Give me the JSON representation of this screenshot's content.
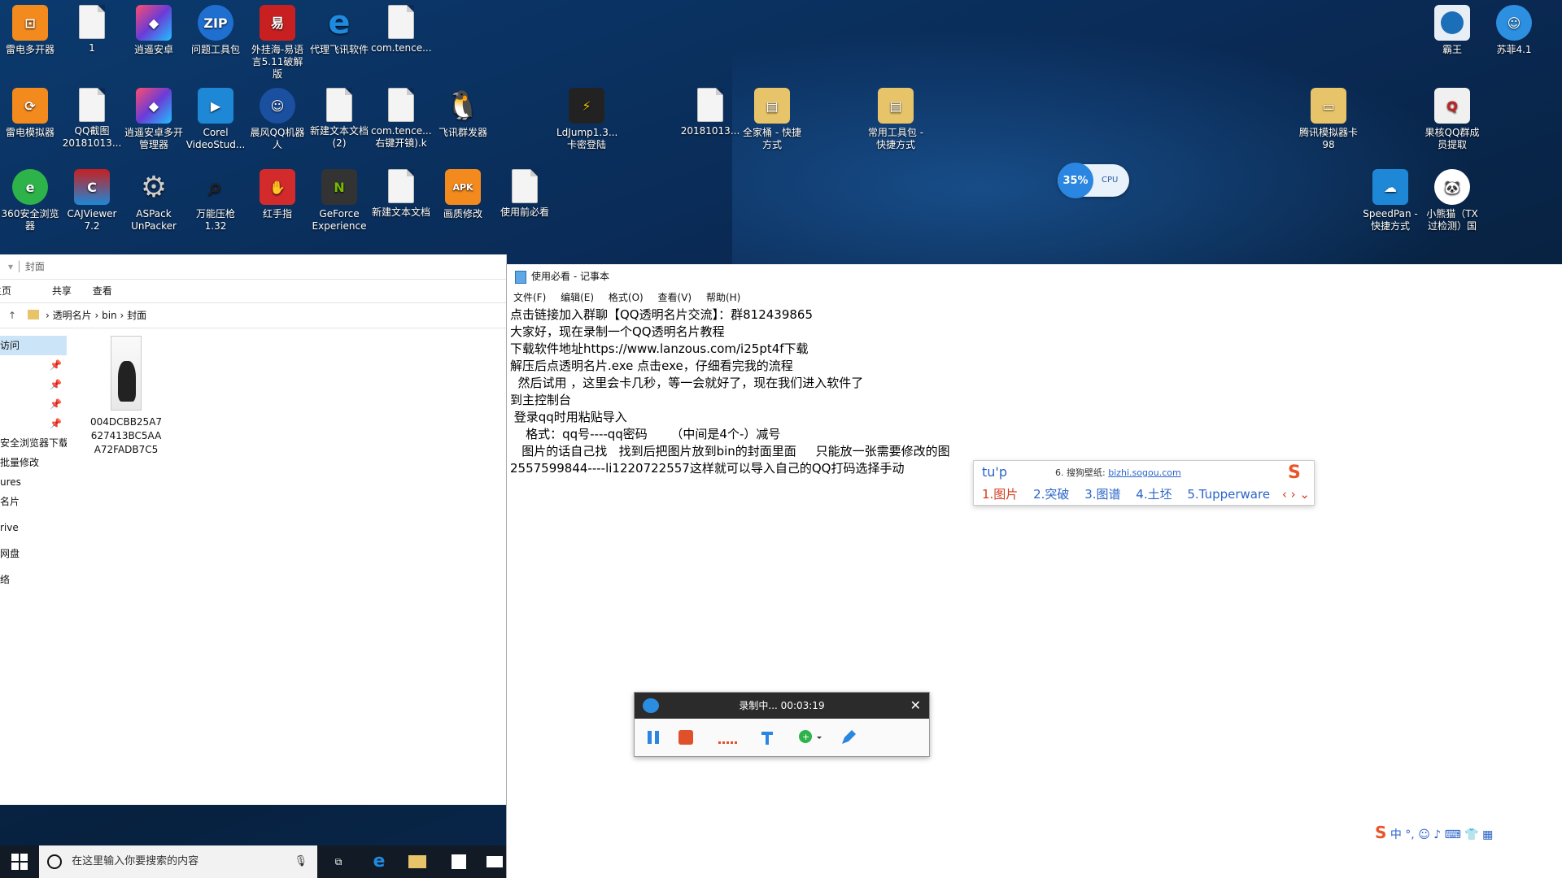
{
  "desktop": {
    "icons": [
      {
        "label": "雷电多开器",
        "icon": "ld-multi-icon",
        "color": "#f28a1d"
      },
      {
        "label": "1",
        "icon": "document-icon",
        "color": "#f4f4f4"
      },
      {
        "label": "逍遥安卓",
        "icon": "xiaoyao-icon",
        "color": "#6b3bd6"
      },
      {
        "label": "问题工具包",
        "icon": "zip-icon",
        "color": "#1f6fd1"
      },
      {
        "label": "外挂海-易语言5.11破解版",
        "icon": "eyuyan-icon",
        "color": "#c82020"
      },
      {
        "label": "代理飞讯软件",
        "icon": "ie-icon",
        "color": "#1f8be0"
      },
      {
        "label": "com.tence...",
        "icon": "document-icon",
        "color": "#f4f4f4"
      },
      {
        "label": "霸王",
        "icon": "bawang-icon",
        "color": "#1b6fb8"
      },
      {
        "label": "苏菲4.1",
        "icon": "doraemon-icon",
        "color": "#2d8fe0"
      },
      {
        "label": "雷电模拟器",
        "icon": "ld-emulator-icon",
        "color": "#f28a1d"
      },
      {
        "label": "QQ截图20181013...",
        "icon": "screenshot-icon",
        "color": "#f4f4f4"
      },
      {
        "label": "逍遥安卓多开管理器",
        "icon": "xiaoyao-multi-icon",
        "color": "#6b3bd6"
      },
      {
        "label": "Corel VideoStud...",
        "icon": "corel-icon",
        "color": "#1e88d6"
      },
      {
        "label": "晨风QQ机器人",
        "icon": "robot-icon",
        "color": "#1b4fa0"
      },
      {
        "label": "新建文本文档(2)",
        "icon": "document-icon",
        "color": "#f4f4f4"
      },
      {
        "label": "com.tence...右键开镜).k",
        "icon": "document-icon",
        "color": "#f4f4f4"
      },
      {
        "label": "飞讯群发器",
        "icon": "qq-penguin-icon",
        "color": "#1b1b1b"
      },
      {
        "label": "LdJump1.3...卡密登陆",
        "icon": "ldjump-icon",
        "color": "#222"
      },
      {
        "label": "20181013...",
        "icon": "document-icon",
        "color": "#f4f4f4"
      },
      {
        "label": "全家桶 - 快捷方式",
        "icon": "folder-shortcut-icon",
        "color": "#e7c46a"
      },
      {
        "label": "常用工具包 - 快捷方式",
        "icon": "folder-shortcut-icon",
        "color": "#e7c46a"
      },
      {
        "label": "腾讯模拟器卡98",
        "icon": "folder-icon",
        "color": "#e7c46a"
      },
      {
        "label": "果核QQ群成员提取",
        "icon": "qq-group-icon",
        "color": "#c82020"
      },
      {
        "label": "360安全浏览器",
        "icon": "browser-360-icon",
        "color": "#2db34a"
      },
      {
        "label": "CAJViewer 7.2",
        "icon": "cajviewer-icon",
        "color": "#c82020"
      },
      {
        "label": "ASPack UnPacker",
        "icon": "gear-icon",
        "color": "#777"
      },
      {
        "label": "万能压枪1.32",
        "icon": "magnifier-icon",
        "color": "#333"
      },
      {
        "label": "红手指",
        "icon": "red-finger-icon",
        "color": "#d32b2b"
      },
      {
        "label": "GeForce Experience",
        "icon": "nvidia-icon",
        "color": "#333"
      },
      {
        "label": "新建文本文档",
        "icon": "document-icon",
        "color": "#f4f4f4"
      },
      {
        "label": "画质修改",
        "icon": "apk-icon",
        "color": "#f28a1d"
      },
      {
        "label": "使用前必看",
        "icon": "document-icon",
        "color": "#f4f4f4"
      },
      {
        "label": "SpeedPan - 快捷方式",
        "icon": "cloud-icon",
        "color": "#1e88d6"
      },
      {
        "label": "小熊猫（TX过检测）国",
        "icon": "panda-icon",
        "color": "#fff"
      }
    ],
    "cpu": {
      "percent": "35%",
      "label": "CPU"
    }
  },
  "explorer": {
    "title": "封面",
    "ribbon": [
      "主页",
      "共享",
      "查看"
    ],
    "breadcrumb": [
      "透明名片",
      "bin",
      "封面"
    ],
    "nav": [
      "访问",
      "",
      "",
      "",
      "",
      "安全浏览器下载",
      "批量修改",
      "ures",
      "名片",
      "rive",
      "网盘",
      "络"
    ],
    "file": {
      "name": "004DCBB25A7627413BC5AAA72FADB7C5"
    }
  },
  "notepad": {
    "title": "使用必看 - 记事本",
    "menu": [
      "文件(F)",
      "编辑(E)",
      "格式(O)",
      "查看(V)",
      "帮助(H)"
    ],
    "lines": [
      "点击链接加入群聊【QQ透明名片交流】：群812439865",
      "大家好，现在录制一个QQ透明名片教程",
      "下载软件地址https://www.lanzous.com/i25pt4f下载",
      "解压后点透明名片.exe 点击exe，仔细看完我的流程",
      "  然后试用 ，这里会卡几秒，等一会就好了，现在我们进入软件了",
      "到主控制台",
      " 登录qq时用粘贴导入",
      "    格式：qq号----qq密码      （中间是4个-）减号",
      "   图片的话自己找   找到后把图片放到bin的封面里面     只能放一张需要修改的图",
      "2557599844----li1220722557这样就可以导入自己的QQ打码选择手动"
    ]
  },
  "ime": {
    "input": "tu'p",
    "tip_num": "6.",
    "tip_text": "搜狗壁纸:",
    "tip_link": "bizhi.sogou.com",
    "candidates": [
      "1.图片",
      "2.突破",
      "3.图谱",
      "4.土坯",
      "5.Tupperware"
    ],
    "logo": "S"
  },
  "recorder": {
    "status": "录制中... 00:03:19"
  },
  "taskbar": {
    "search_placeholder": "在这里输入你要搜索的内容",
    "tray": "中 °, ☺ ♪ ⌨ 👕 ▦"
  },
  "colors": {
    "accent": "#2a64c8",
    "record": "#e0502a",
    "taskbar": "#111a25"
  }
}
